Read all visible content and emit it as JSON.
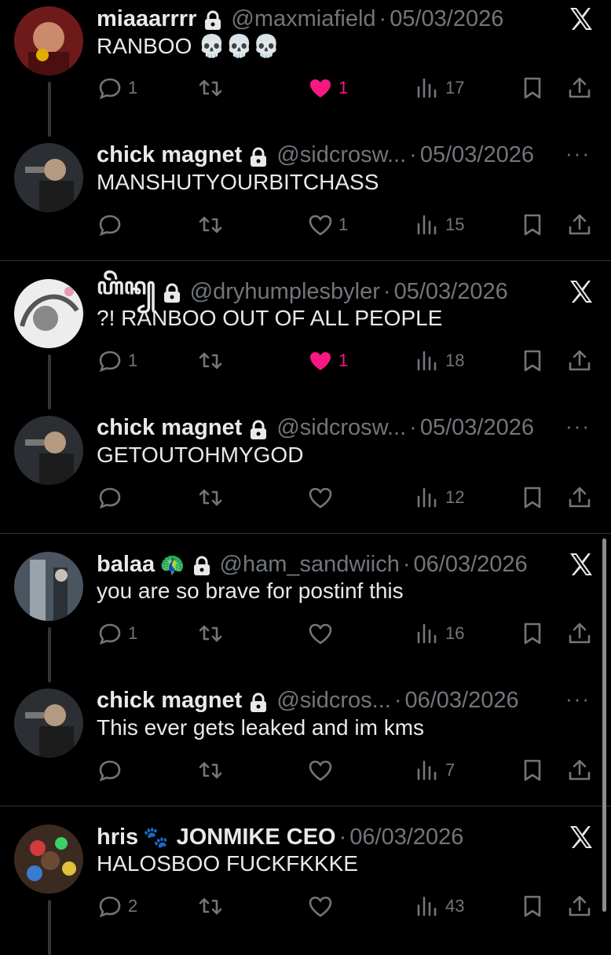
{
  "tweets": [
    {
      "name": "miaaarrrr",
      "badge": "",
      "handle": "@maxmiafield",
      "date": "05/03/2026",
      "text": "RANBOO 💀💀💀",
      "corner": "x-logo",
      "reply": "1",
      "retweet": "",
      "like": "1",
      "liked": true,
      "views": "17",
      "avatar_color": "#7a1f1f"
    },
    {
      "name": "chick magnet",
      "badge": "",
      "handle": "@sidcrosw...",
      "date": "05/03/2026",
      "text": "MANSHUTYOURBITCHASS",
      "corner": "more",
      "reply": "",
      "retweet": "",
      "like": "1",
      "liked": false,
      "views": "15",
      "avatar_color": "#3a3f44"
    },
    {
      "name": "ꦲꦼꦤ꧀",
      "badge": "",
      "handle": "@dryhumplesbyler",
      "date": "05/03/2026",
      "text": "?! RANBOO OUT OF ALL PEOPLE",
      "corner": "x-logo",
      "reply": "1",
      "retweet": "",
      "like": "1",
      "liked": true,
      "views": "18",
      "avatar_color": "#d9d9d9"
    },
    {
      "name": "chick magnet",
      "badge": "",
      "handle": "@sidcrosw...",
      "date": "05/03/2026",
      "text": "GETOUTOHMYGOD",
      "corner": "more",
      "reply": "",
      "retweet": "",
      "like": "",
      "liked": false,
      "views": "12",
      "avatar_color": "#3a3f44"
    },
    {
      "name": "balaa",
      "badge": "🦚",
      "handle": "@ham_sandwiich",
      "date": "06/03/2026",
      "text": "you are so brave for postinf this",
      "corner": "x-logo",
      "reply": "1",
      "retweet": "",
      "like": "",
      "liked": false,
      "views": "16",
      "avatar_color": "#5c6770"
    },
    {
      "name": "chick magnet",
      "badge": "",
      "handle": "@sidcros...",
      "date": "06/03/2026",
      "text": "This ever gets leaked and im kms",
      "corner": "more",
      "reply": "",
      "retweet": "",
      "like": "",
      "liked": false,
      "views": "7",
      "avatar_color": "#3a3f44"
    },
    {
      "name": "hris",
      "badge": "🐾",
      "handle": "JONMIKE CEO",
      "date": "06/03/2026",
      "text": "HALOSBOO FUCKFKKKE",
      "corner": "x-logo",
      "reply": "2",
      "retweet": "",
      "like": "",
      "liked": false,
      "views": "43",
      "avatar_color": "#3b2a1f",
      "handle_bold": true
    }
  ],
  "icons": {
    "reply": "reply-icon",
    "retweet": "retweet-icon",
    "like": "heart-icon",
    "views": "views-icon",
    "bookmark": "bookmark-icon",
    "share": "share-icon",
    "lock": "lock-icon",
    "x": "x-logo-icon",
    "more": "more-icon"
  },
  "colors": {
    "like_active": "#f91880",
    "muted": "#71767b",
    "text": "#e7e9ea",
    "background": "#000000"
  }
}
